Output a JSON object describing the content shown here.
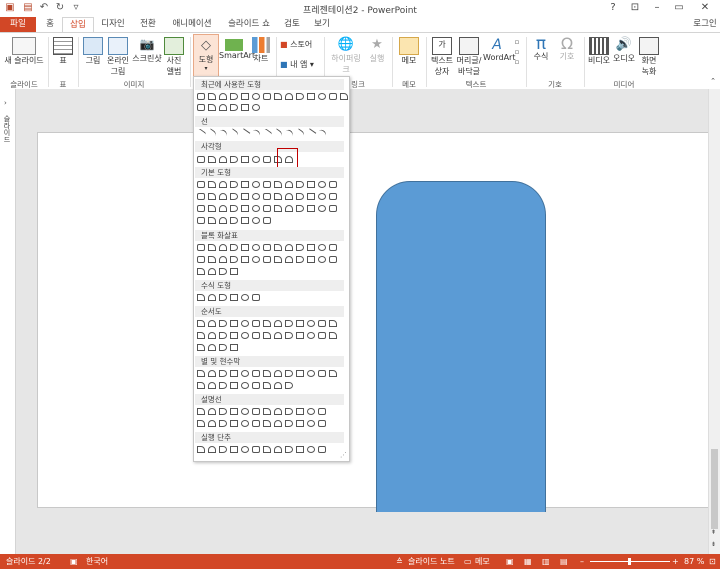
{
  "window": {
    "title": "프레젠테이션2 - PowerPoint",
    "user": "로그인"
  },
  "tabs": [
    "파일",
    "홈",
    "삽입",
    "디자인",
    "전환",
    "애니메이션",
    "슬라이드 쇼",
    "검토",
    "보기"
  ],
  "ribbon": {
    "new_slide": "새 슬라이드",
    "table": "표",
    "picture": "그림",
    "online_picture": "온라인 그림",
    "screenshot": "스크린샷",
    "photo_album": "사진 앨범",
    "shapes": "도형",
    "smartart": "SmartArt",
    "chart": "차트",
    "store": "스토어",
    "my_apps": "내 앱",
    "hyperlink": "하이퍼링크",
    "action": "실행",
    "comment": "메모",
    "textbox": "텍스트 상자",
    "header_footer": "머리글/바닥글",
    "wordart": "WordArt",
    "equation": "수식",
    "symbol": "기호",
    "video": "비디오",
    "audio": "오디오",
    "screen_recording": "화면 녹화",
    "groups": {
      "slides": "슬라이드",
      "tables": "표",
      "images": "이미지",
      "links": "링크",
      "comments": "메모",
      "text": "텍스트",
      "symbols": "기호",
      "media": "미디어"
    }
  },
  "gallery": {
    "sections": [
      "최근에 사용한 도형",
      "선",
      "사각형",
      "기본 도형",
      "블록 화살표",
      "수식 도형",
      "순서도",
      "별 및 현수막",
      "설명선",
      "실행 단추"
    ]
  },
  "left_pane": {
    "label": "슬라이드"
  },
  "status": {
    "slide": "슬라이드 2/2",
    "language": "한국어",
    "notes": "슬라이드 노트",
    "comments": "메모",
    "zoom": "87 %"
  },
  "colors": {
    "accent": "#d24726",
    "shape_fill": "#5b9bd5",
    "highlight": "#c00000"
  }
}
